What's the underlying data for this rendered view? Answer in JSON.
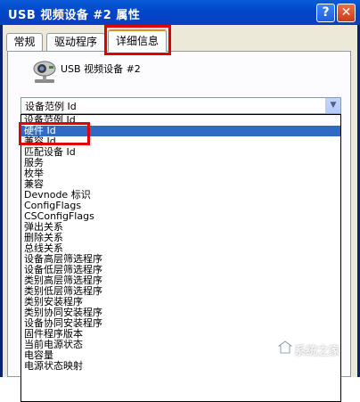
{
  "window": {
    "title": "USB 视频设备 #2 属性",
    "help_label": "?",
    "close_label": "✕"
  },
  "tabs": [
    {
      "label": "常规",
      "active": false
    },
    {
      "label": "驱动程序",
      "active": false
    },
    {
      "label": "详细信息",
      "active": true
    }
  ],
  "device": {
    "name": "USB 视频设备 #2",
    "icon": "webcam-icon"
  },
  "property_select": {
    "value": "设备范例 Id",
    "options": [
      "设备范例 Id",
      "硬件 Id",
      "兼容 Id",
      "匹配设备 Id",
      "服务",
      "枚举",
      "兼容",
      "Devnode 标识",
      "ConfigFlags",
      "CSConfigFlags",
      "弹出关系",
      "删除关系",
      "总线关系",
      "设备高层筛选程序",
      "设备低层筛选程序",
      "类别高层筛选程序",
      "类别低层筛选程序",
      "类别安装程序",
      "类别协同安装程序",
      "设备协同安装程序",
      "固件程序版本",
      "当前电源状态",
      "电容量",
      "电源状态映射"
    ],
    "highlighted_index": 1
  },
  "watermark": {
    "text": "系统之家"
  },
  "colors": {
    "titlebar": "#0047c9",
    "selection": "#316ac5",
    "annotation_red": "#e00000"
  }
}
